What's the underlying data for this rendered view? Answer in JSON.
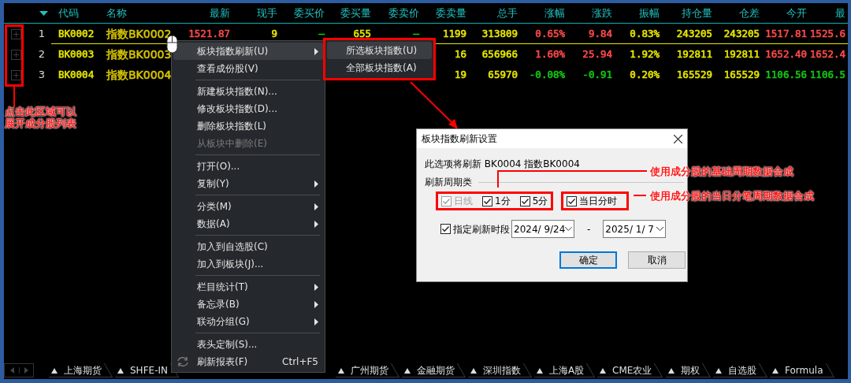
{
  "table": {
    "columns": [
      "代码",
      "名称",
      "最新",
      "现手",
      "委买价",
      "委买量",
      "委卖价",
      "委卖量",
      "总手",
      "涨幅",
      "涨跌",
      "振幅",
      "持仓量",
      "仓差",
      "今开",
      "最"
    ],
    "rows": [
      {
        "index": "1",
        "selected": true,
        "cells": [
          {
            "text": "BK0002",
            "color": "#e6e600"
          },
          {
            "text": "指数BK0002",
            "color": "#d4c400"
          },
          {
            "text": "1521.87",
            "color": "#ff4a4a"
          },
          {
            "text": "9",
            "color": "#e6e600"
          },
          {
            "text": "—",
            "color": "#12c912"
          },
          {
            "text": "655",
            "color": "#e6e600"
          },
          {
            "text": "—",
            "color": "#12c912"
          },
          {
            "text": "1199",
            "color": "#e6e600"
          },
          {
            "text": "313809",
            "color": "#e6e600"
          },
          {
            "text": "0.65%",
            "color": "#ff4a4a"
          },
          {
            "text": "9.84",
            "color": "#ff4a4a"
          },
          {
            "text": "0.83%",
            "color": "#e6e600"
          },
          {
            "text": "243205",
            "color": "#e6e600"
          },
          {
            "text": "243205",
            "color": "#e6e600"
          },
          {
            "text": "1517.81",
            "color": "#ff4a4a"
          },
          {
            "text": "1525.6",
            "color": "#ff4a4a"
          }
        ]
      },
      {
        "index": "2",
        "selected": false,
        "cells": [
          {
            "text": "BK0003",
            "color": "#e6e600"
          },
          {
            "text": "指数BK0003",
            "color": "#d4c400"
          },
          null,
          null,
          null,
          null,
          null,
          {
            "text": "16",
            "color": "#e6e600"
          },
          {
            "text": "656966",
            "color": "#e6e600"
          },
          {
            "text": "1.60%",
            "color": "#ff4a4a"
          },
          {
            "text": "25.94",
            "color": "#ff4a4a"
          },
          {
            "text": "1.92%",
            "color": "#e6e600"
          },
          {
            "text": "192811",
            "color": "#e6e600"
          },
          {
            "text": "192811",
            "color": "#e6e600"
          },
          {
            "text": "1652.40",
            "color": "#ff4a4a"
          },
          {
            "text": "1652.4",
            "color": "#ff4a4a"
          }
        ]
      },
      {
        "index": "3",
        "selected": false,
        "cells": [
          {
            "text": "BK0004",
            "color": "#e6e600"
          },
          {
            "text": "指数BK0004",
            "color": "#d4c400"
          },
          null,
          null,
          null,
          null,
          null,
          {
            "text": "19",
            "color": "#e6e600"
          },
          {
            "text": "65970",
            "color": "#e6e600"
          },
          {
            "text": "-0.08%",
            "color": "#12c912"
          },
          {
            "text": "-0.91",
            "color": "#12c912"
          },
          {
            "text": "0.20%",
            "color": "#e6e600"
          },
          {
            "text": "165529",
            "color": "#e6e600"
          },
          {
            "text": "165529",
            "color": "#e6e600"
          },
          {
            "text": "1106.56",
            "color": "#12c912"
          },
          {
            "text": "1106.5",
            "color": "#12c912"
          }
        ]
      }
    ]
  },
  "context_menu": {
    "items": [
      {
        "kind": "item",
        "label": "板块指数刷新(U)",
        "submenu": true,
        "selected": true,
        "disabled": false
      },
      {
        "kind": "item",
        "label": "查看成份股(V)",
        "submenu": false,
        "selected": false,
        "disabled": false
      },
      {
        "kind": "separator"
      },
      {
        "kind": "item",
        "label": "新建板块指数(N)...",
        "submenu": false,
        "selected": false,
        "disabled": false
      },
      {
        "kind": "item",
        "label": "修改板块指数(D)...",
        "submenu": false,
        "selected": false,
        "disabled": false
      },
      {
        "kind": "item",
        "label": "删除板块指数(L)",
        "submenu": false,
        "selected": false,
        "disabled": false
      },
      {
        "kind": "item",
        "label": "从板块中删除(E)",
        "submenu": false,
        "selected": false,
        "disabled": true
      },
      {
        "kind": "separator"
      },
      {
        "kind": "item",
        "label": "打开(O)...",
        "submenu": false,
        "selected": false,
        "disabled": false
      },
      {
        "kind": "item",
        "label": "复制(Y)",
        "submenu": true,
        "selected": false,
        "disabled": false
      },
      {
        "kind": "separator"
      },
      {
        "kind": "item",
        "label": "分类(M)",
        "submenu": true,
        "selected": false,
        "disabled": false
      },
      {
        "kind": "item",
        "label": "数据(A)",
        "submenu": true,
        "selected": false,
        "disabled": false
      },
      {
        "kind": "separator"
      },
      {
        "kind": "item",
        "label": "加入到自选股(C)",
        "submenu": false,
        "selected": false,
        "disabled": false
      },
      {
        "kind": "item",
        "label": "加入到板块(J)...",
        "submenu": false,
        "selected": false,
        "disabled": false
      },
      {
        "kind": "separator"
      },
      {
        "kind": "item",
        "label": "栏目统计(T)",
        "submenu": true,
        "selected": false,
        "disabled": false
      },
      {
        "kind": "item",
        "label": "备忘录(B)",
        "submenu": true,
        "selected": false,
        "disabled": false
      },
      {
        "kind": "item",
        "label": "联动分组(G)",
        "submenu": true,
        "selected": false,
        "disabled": false
      },
      {
        "kind": "separator"
      },
      {
        "kind": "item",
        "label": "表头定制(S)...",
        "submenu": false,
        "selected": false,
        "disabled": false
      },
      {
        "kind": "refresh_item",
        "label": "刷新报表(F)",
        "submenu": false,
        "selected": false,
        "disabled": false,
        "shortcut": "Ctrl+F5"
      }
    ]
  },
  "submenu": {
    "items": [
      {
        "label": "所选板块指数(U)",
        "selected": true
      },
      {
        "label": "全部板块指数(A)",
        "selected": false
      }
    ]
  },
  "dialog": {
    "title": "板块指数刷新设置",
    "message": "此选项将刷新 BK0004 指数BK0004",
    "group_label": "刷新周期类",
    "periods": [
      {
        "label": "日线",
        "checked": true,
        "disabled": true
      },
      {
        "label": "1分",
        "checked": true,
        "disabled": false
      },
      {
        "label": "5分",
        "checked": true,
        "disabled": false
      },
      {
        "label": "当日分时",
        "checked": true,
        "disabled": false
      }
    ],
    "range": {
      "label": "指定刷新时段",
      "checked": true,
      "from": "2024/ 9/24",
      "separator": "-",
      "to": "2025/ 1/ 7"
    },
    "buttons": [
      {
        "label": "确定",
        "default": true
      },
      {
        "label": "取消",
        "default": false
      }
    ]
  },
  "annotations": [
    "点击此区域可以展开成分股列表",
    "使用成分股的基础周期数据合成",
    "使用成分股的当日分笔周期数据合成"
  ],
  "bottom_tabs": [
    "上海期货",
    "SHFE-IN",
    "广州期货",
    "金融期货",
    "深圳指数",
    "上海A股",
    "CME农业",
    "期权",
    "自选股",
    "Formula"
  ]
}
